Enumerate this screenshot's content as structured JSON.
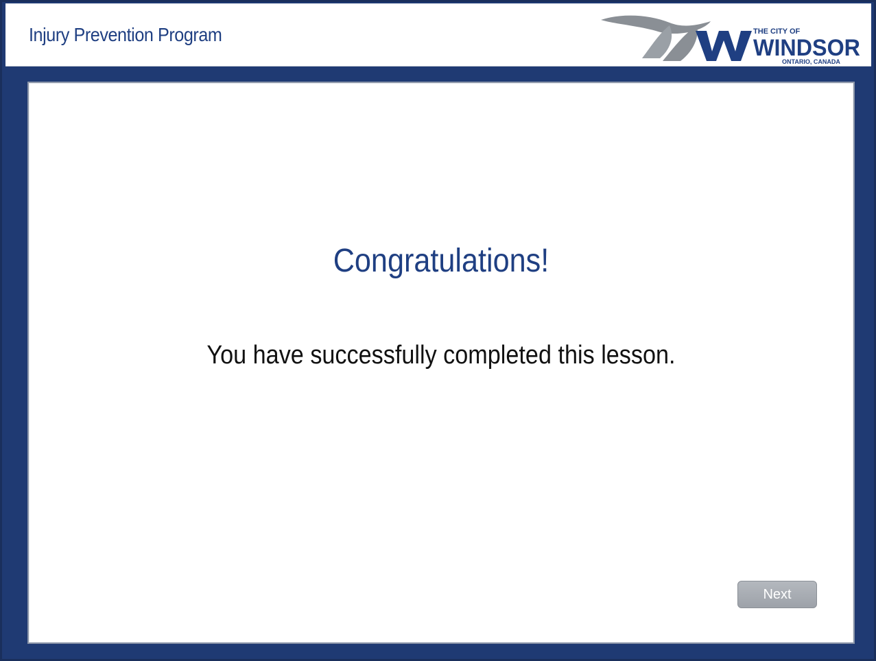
{
  "header": {
    "title": "Injury Prevention Program",
    "logo": {
      "top_text": "THE CITY OF",
      "main_text": "WINDSOR",
      "sub_text": "ONTARIO, CANADA",
      "icon": "windsor-wave-logo"
    }
  },
  "main": {
    "heading": "Congratulations!",
    "message": "You have successfully completed this lesson."
  },
  "nav": {
    "next_label": "Next"
  },
  "colors": {
    "background_blue": "#1f3a73",
    "title_blue": "#1f3f82",
    "button_gray": "#a8acb2"
  }
}
